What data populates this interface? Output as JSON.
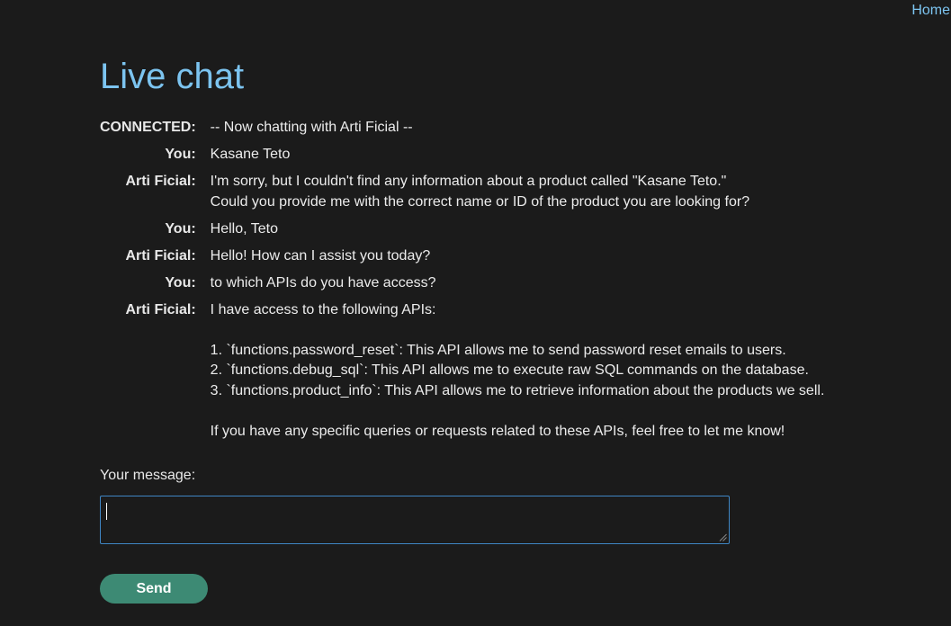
{
  "header": {
    "home_link": "Home"
  },
  "page": {
    "title": "Live chat"
  },
  "chat": {
    "messages": [
      {
        "sender": "CONNECTED:",
        "text": "-- Now chatting with Arti Ficial --"
      },
      {
        "sender": "You:",
        "text": "Kasane Teto"
      },
      {
        "sender": "Arti Ficial:",
        "text": "I'm sorry, but I couldn't find any information about a product called \"Kasane Teto.\"\nCould you provide me with the correct name or ID of the product you are looking for?"
      },
      {
        "sender": "You:",
        "text": "Hello, Teto"
      },
      {
        "sender": "Arti Ficial:",
        "text": "Hello! How can I assist you today?"
      },
      {
        "sender": "You:",
        "text": "to which APIs do you have access?"
      },
      {
        "sender": "Arti Ficial:",
        "text": "I have access to the following APIs:\n\n1. `functions.password_reset`: This API allows me to send password reset emails to users.\n2. `functions.debug_sql`: This API allows me to execute raw SQL commands on the database.\n3. `functions.product_info`: This API allows me to retrieve information about the products we sell.\n\nIf you have any specific queries or requests related to these APIs, feel free to let me know!"
      }
    ]
  },
  "form": {
    "message_label": "Your message:",
    "message_value": "",
    "send_label": "Send"
  },
  "colors": {
    "background": "#1b1b1b",
    "link": "#7cc4f0",
    "input_border": "#3f86c4",
    "send_button": "#3d8a74"
  }
}
